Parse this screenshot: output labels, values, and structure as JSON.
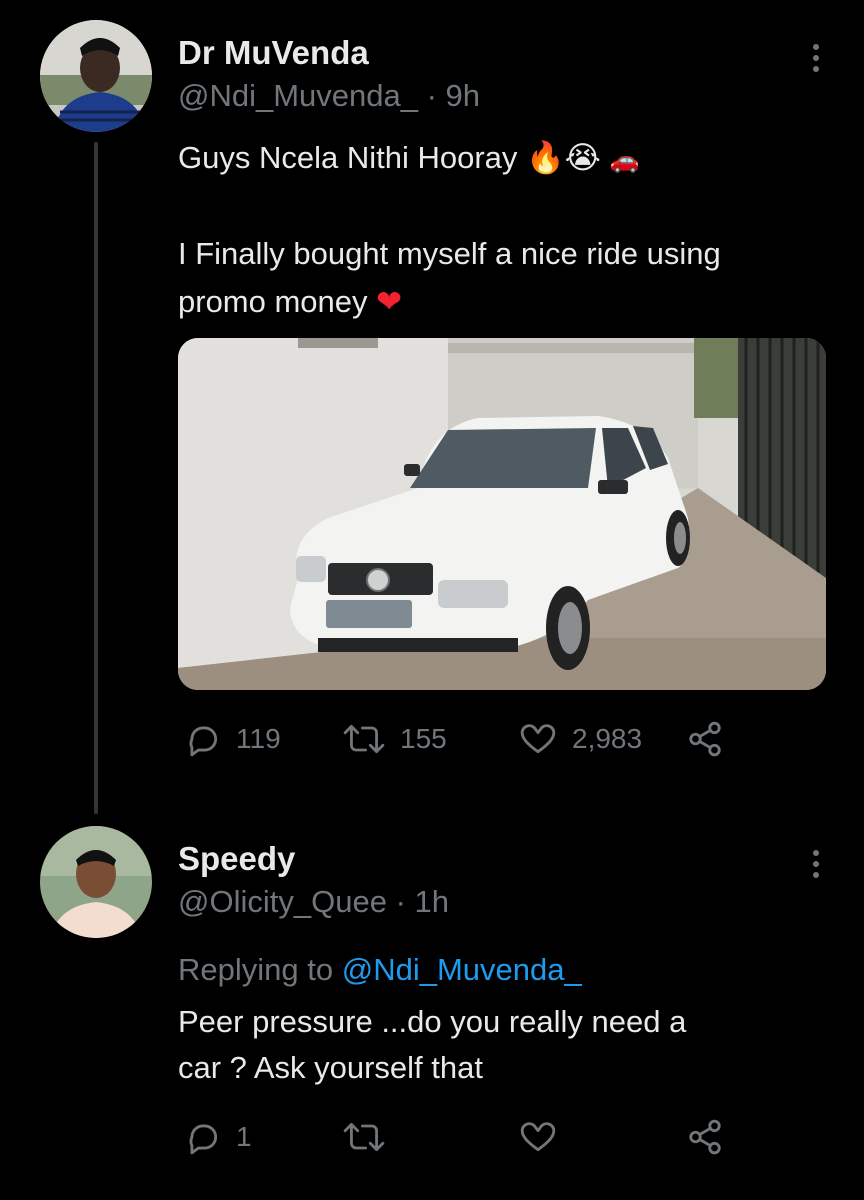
{
  "tweet": {
    "author_name": "Dr MuVenda",
    "author_handle": "@Ndi_Muvenda_",
    "time": "· 9h",
    "line1": "Guys Ncela Nithi Hooray",
    "line1_emoji": "🔥😭",
    "line1_tail": "🚗",
    "line2": "I Finally bought myself a nice ride using",
    "line3": "promo money",
    "line3_emoji": "❤️",
    "replies": "119",
    "retweets": "155",
    "likes": "2,983"
  },
  "reply": {
    "author_name": "Speedy",
    "author_handle": "@Olicity_Quee",
    "time": "· 1h",
    "replying_prefix": "Replying to",
    "replying_to": "@Ndi_Muvenda_",
    "line1": "Peer pressure ...do you really need a",
    "line2": "car ? Ask yourself that",
    "replies": "1"
  },
  "colors": {
    "background": "#000000",
    "text": "#e7e9ea",
    "muted": "#71767b",
    "link": "#1d9bf0",
    "thread_line": "#333639",
    "heart": "#f4212e"
  },
  "icons": [
    "more-icon",
    "reply-icon",
    "retweet-icon",
    "like-icon",
    "share-icon"
  ]
}
